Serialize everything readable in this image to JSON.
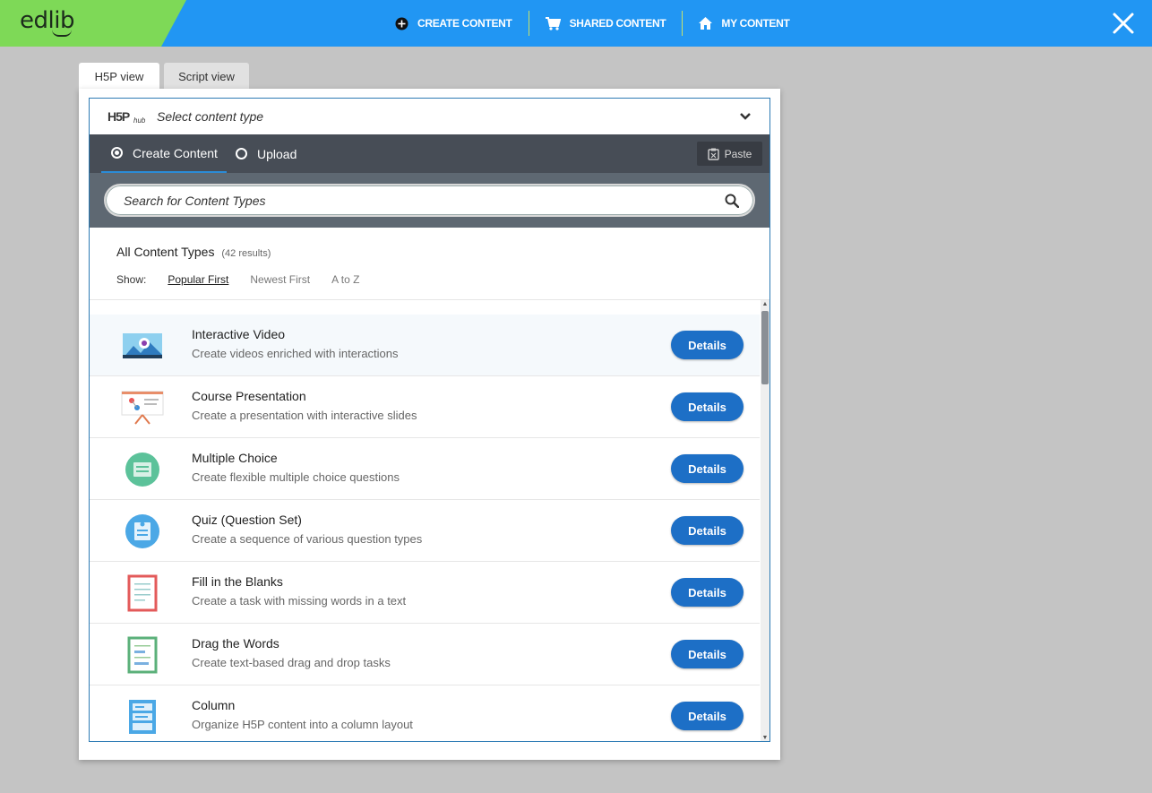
{
  "app": {
    "logo_text": "edlib",
    "brand_colors": {
      "bar": "#2196f3",
      "logo_bg": "#7ed957",
      "button": "#1d6fc6",
      "hub_dark": "#474d56"
    }
  },
  "nav": {
    "items": [
      {
        "label": "CREATE CONTENT",
        "icon": "plus-circle-icon"
      },
      {
        "label": "SHARED CONTENT",
        "icon": "cart-icon"
      },
      {
        "label": "MY CONTENT",
        "icon": "home-icon"
      }
    ],
    "close_icon": "close-icon"
  },
  "tabs": {
    "h5p": "H5P view",
    "script": "Script view",
    "active": "H5P view"
  },
  "hub": {
    "logo": "H5P",
    "logo_sub": "hub",
    "select_title": "Select content type",
    "tab_create": "Create Content",
    "tab_upload": "Upload",
    "paste_label": "Paste",
    "search_placeholder": "Search for Content Types",
    "results_title": "All Content Types",
    "results_count": "(42 results)",
    "show_label": "Show:",
    "sort_options": [
      "Popular First",
      "Newest First",
      "A to Z"
    ],
    "sort_selected": "Popular First",
    "details_label": "Details",
    "items": [
      {
        "title": "Interactive Video",
        "desc": "Create videos enriched with interactions",
        "icon": "interactive-video-icon"
      },
      {
        "title": "Course Presentation",
        "desc": "Create a presentation with interactive slides",
        "icon": "course-presentation-icon"
      },
      {
        "title": "Multiple Choice",
        "desc": "Create flexible multiple choice questions",
        "icon": "multiple-choice-icon"
      },
      {
        "title": "Quiz (Question Set)",
        "desc": "Create a sequence of various question types",
        "icon": "question-set-icon"
      },
      {
        "title": "Fill in the Blanks",
        "desc": "Create a task with missing words in a text",
        "icon": "fill-blanks-icon"
      },
      {
        "title": "Drag the Words",
        "desc": "Create text-based drag and drop tasks",
        "icon": "drag-words-icon"
      },
      {
        "title": "Column",
        "desc": "Organize H5P content into a column layout",
        "icon": "column-icon"
      }
    ]
  }
}
